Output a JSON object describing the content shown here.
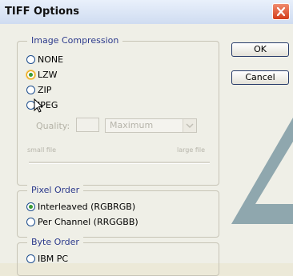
{
  "window": {
    "title": "TIFF Options"
  },
  "image_compression": {
    "title": "Image Compression",
    "options": [
      "NONE",
      "LZW",
      "ZIP",
      "JPEG"
    ],
    "selected": "LZW",
    "quality": {
      "label": "Quality:",
      "value": "",
      "select_value": "Maximum",
      "small_label": "small file",
      "large_label": "large file"
    }
  },
  "pixel_order": {
    "title": "Pixel Order",
    "options": [
      "Interleaved (RGBRGB)",
      "Per Channel (RRGGBB)"
    ],
    "selected": "Interleaved (RGBRGB)"
  },
  "byte_order": {
    "title": "Byte Order",
    "options": [
      "IBM PC"
    ]
  },
  "buttons": {
    "ok": "OK",
    "cancel": "Cancel"
  },
  "colors": {
    "title_bar": "#dde6f5",
    "close_button": "#e05a36",
    "group_title": "#2c3a8c",
    "watermark": "#7e9aa3"
  },
  "icons": {
    "close": "close-icon",
    "cursor": "mouse-pointer-icon",
    "watermark": "adobe-watermark"
  }
}
